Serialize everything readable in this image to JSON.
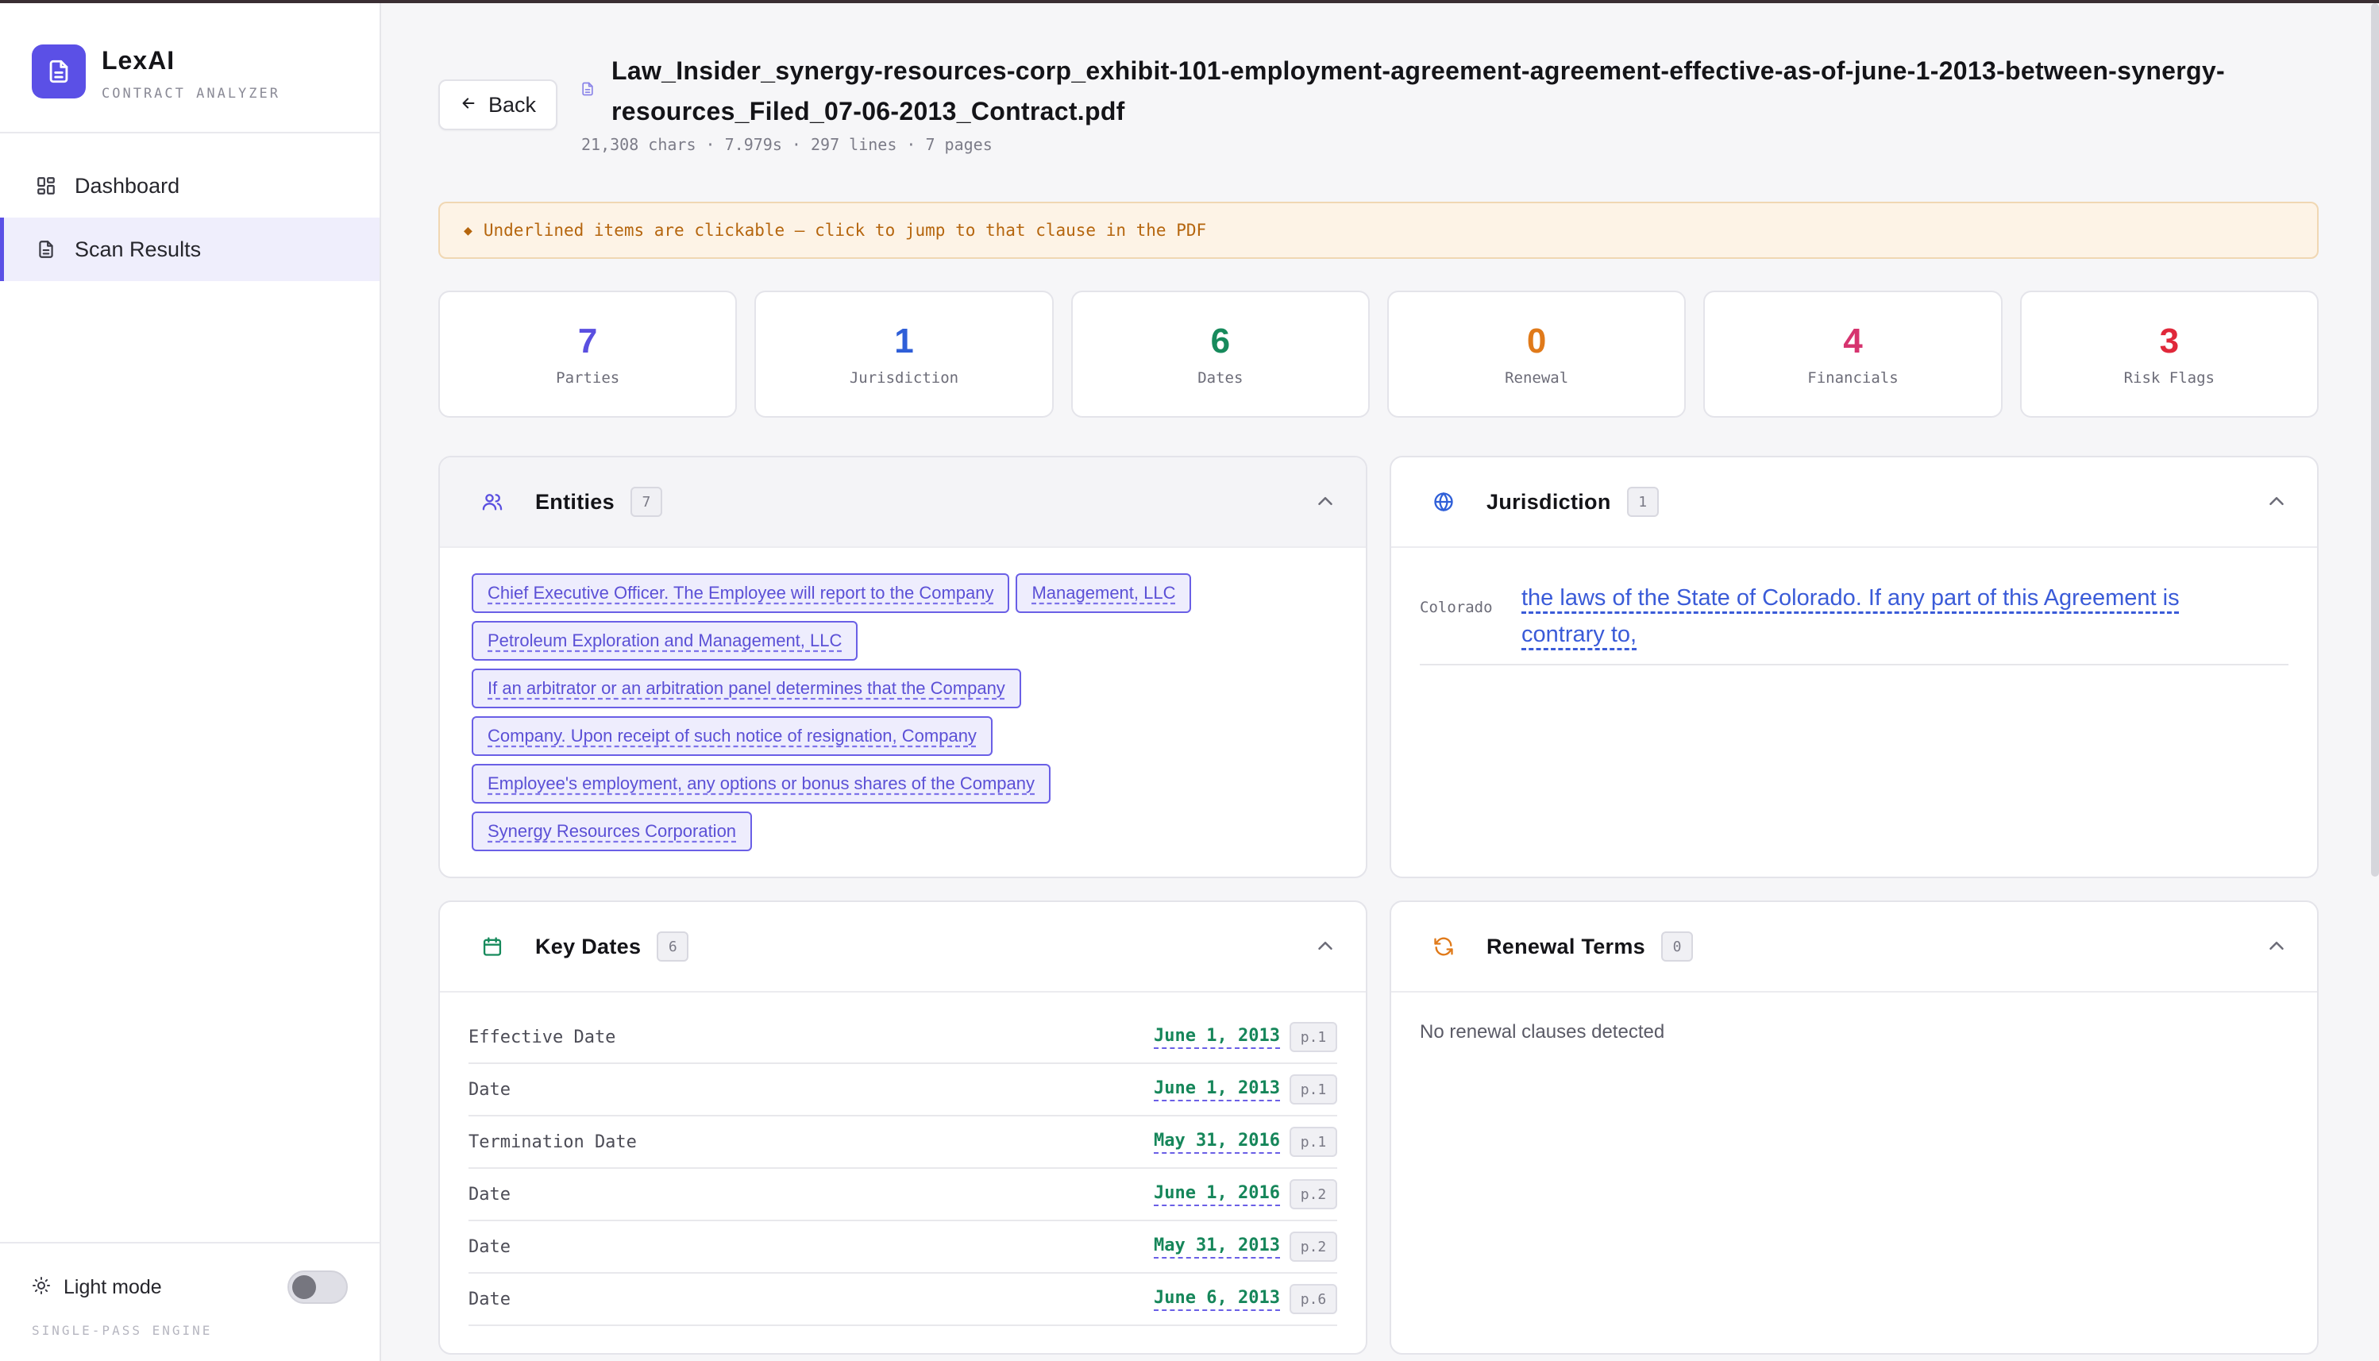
{
  "brand": {
    "name": "LexAI",
    "subtitle": "CONTRACT ANALYZER"
  },
  "nav": {
    "items": [
      {
        "label": "Dashboard"
      },
      {
        "label": "Scan Results"
      }
    ]
  },
  "sidebar_footer": {
    "mode_label": "Light mode",
    "engine": "SINGLE-PASS ENGINE"
  },
  "header": {
    "back_label": "Back",
    "file_name": "Law_Insider_synergy-resources-corp_exhibit-101-employment-agreement-agreement-effective-as-of-june-1-2013-between-synergy-resources_Filed_07-06-2013_Contract.pdf",
    "meta": "21,308 chars · 7.979s · 297 lines · 7 pages"
  },
  "notice": "Underlined items are clickable — click to jump to that clause in the PDF",
  "stats": [
    {
      "value": "7",
      "label": "Parties",
      "color": "#5a4fe0"
    },
    {
      "value": "1",
      "label": "Jurisdiction",
      "color": "#2f5fd8"
    },
    {
      "value": "6",
      "label": "Dates",
      "color": "#178a5c"
    },
    {
      "value": "0",
      "label": "Renewal",
      "color": "#e07a1a"
    },
    {
      "value": "4",
      "label": "Financials",
      "color": "#d6346f"
    },
    {
      "value": "3",
      "label": "Risk Flags",
      "color": "#e0283a"
    }
  ],
  "entities": {
    "title": "Entities",
    "count": "7",
    "items": [
      "Chief Executive Officer. The Employee will report to the Company",
      "Management, LLC",
      "Petroleum Exploration and Management, LLC",
      "If an arbitrator or an arbitration panel determines that the Company",
      "Company. Upon receipt of such notice of resignation, Company",
      "Employee's employment, any options or bonus shares of the Company",
      "Synergy Resources Corporation"
    ]
  },
  "jurisdiction": {
    "title": "Jurisdiction",
    "count": "1",
    "key": "Colorado",
    "value": "the laws of the State of Colorado. If any part of this Agreement is contrary to,"
  },
  "key_dates": {
    "title": "Key Dates",
    "count": "6",
    "rows": [
      {
        "label": "Effective Date",
        "date": "June 1, 2013",
        "page": "p.1"
      },
      {
        "label": "Date",
        "date": "June 1, 2013",
        "page": "p.1"
      },
      {
        "label": "Termination Date",
        "date": "May 31, 2016",
        "page": "p.1"
      },
      {
        "label": "Date",
        "date": "June 1, 2016",
        "page": "p.2"
      },
      {
        "label": "Date",
        "date": "May 31, 2013",
        "page": "p.2"
      },
      {
        "label": "Date",
        "date": "June 6, 2013",
        "page": "p.6"
      }
    ]
  },
  "renewal": {
    "title": "Renewal Terms",
    "count": "0",
    "empty_text": "No renewal clauses detected"
  },
  "colors": {
    "accent": "#5b50e6",
    "notice_text": "#b5650d"
  }
}
